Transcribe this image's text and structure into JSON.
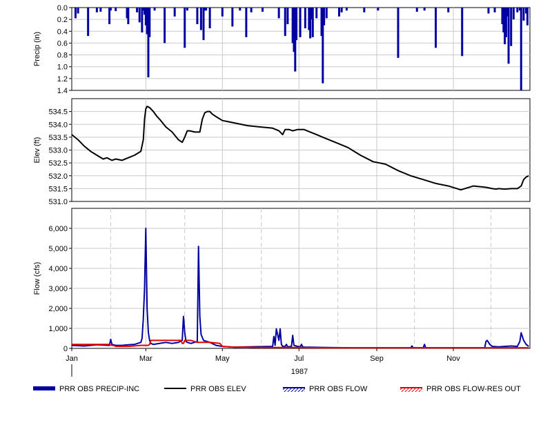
{
  "chart_data": [
    {
      "type": "bar",
      "panel": "precip",
      "ylabel": "Precip (in)",
      "yticks": [
        "0.0",
        "0.2",
        "0.4",
        "0.6",
        "0.8",
        "1.0",
        "1.2",
        "1.4"
      ],
      "ylim": [
        0,
        1.4
      ],
      "y_inverted": true,
      "grid": true,
      "series": [
        {
          "name": "PRR OBS PRECIP-INC",
          "color": "#0000a0",
          "x_days": [
            3,
            5,
            13,
            20,
            23,
            30,
            31,
            35,
            44,
            45,
            52,
            54,
            56,
            57,
            58,
            59,
            60,
            61,
            62,
            66,
            74,
            82,
            90,
            92,
            100,
            103,
            105,
            106,
            107,
            110,
            120,
            128,
            134,
            139,
            143,
            152,
            165,
            170,
            172,
            176,
            177,
            178,
            179,
            182,
            186,
            189,
            190,
            191,
            192,
            195,
            199,
            200,
            201,
            203,
            213,
            215,
            219,
            233,
            244,
            260,
            275,
            281,
            290,
            300,
            311,
            332,
            337,
            343,
            344,
            345,
            346,
            347,
            348,
            350,
            352,
            355,
            357,
            358,
            360,
            362,
            363
          ],
          "values": [
            0.18,
            0.1,
            0.48,
            0.08,
            0.07,
            0.28,
            0.05,
            0.06,
            0.18,
            0.28,
            0.08,
            0.25,
            0.42,
            0.05,
            0.12,
            0.3,
            0.45,
            1.18,
            0.5,
            0.05,
            0.6,
            0.15,
            0.68,
            0.05,
            0.28,
            0.38,
            0.55,
            0.05,
            0.05,
            0.35,
            0.15,
            0.32,
            0.05,
            0.5,
            0.08,
            0.07,
            0.18,
            0.48,
            0.28,
            0.6,
            0.75,
            1.08,
            0.55,
            0.5,
            0.35,
            0.38,
            0.52,
            0.2,
            0.5,
            0.18,
            0.48,
            1.28,
            0.3,
            0.18,
            0.15,
            0.08,
            0.05,
            0.08,
            0.05,
            0.85,
            0.07,
            0.05,
            0.68,
            0.08,
            0.82,
            0.1,
            0.08,
            0.28,
            0.42,
            0.62,
            0.5,
            0.15,
            0.95,
            0.65,
            0.2,
            0.08,
            0.05,
            1.4,
            0.22,
            0.1,
            0.3
          ]
        }
      ]
    },
    {
      "type": "line",
      "panel": "elev",
      "ylabel": "Elev (ft)",
      "yticks": [
        "531.0",
        "531.5",
        "532.0",
        "532.5",
        "533.0",
        "533.5",
        "534.0",
        "534.5"
      ],
      "ylim": [
        531.0,
        535.0
      ],
      "grid": true,
      "series": [
        {
          "name": "PRR OBS ELEV",
          "color": "#000000",
          "x_days": [
            0,
            5,
            10,
            15,
            20,
            25,
            28,
            32,
            35,
            40,
            45,
            50,
            55,
            57,
            58,
            59,
            60,
            62,
            65,
            68,
            70,
            75,
            80,
            85,
            88,
            90,
            92,
            94,
            98,
            102,
            104,
            106,
            108,
            110,
            112,
            115,
            120,
            125,
            130,
            140,
            150,
            160,
            165,
            168,
            170,
            173,
            176,
            180,
            185,
            190,
            195,
            200,
            210,
            220,
            230,
            240,
            250,
            260,
            270,
            280,
            290,
            300,
            310,
            320,
            330,
            335,
            338,
            340,
            345,
            350,
            355,
            358,
            360,
            362,
            364
          ],
          "values": [
            533.6,
            533.4,
            533.15,
            532.95,
            532.8,
            532.65,
            532.7,
            532.6,
            532.65,
            532.6,
            532.7,
            532.8,
            532.95,
            533.4,
            534.2,
            534.6,
            534.7,
            534.65,
            534.5,
            534.3,
            534.2,
            533.9,
            533.7,
            533.4,
            533.3,
            533.5,
            533.75,
            533.75,
            533.7,
            533.7,
            534.2,
            534.45,
            534.5,
            534.5,
            534.4,
            534.3,
            534.15,
            534.1,
            534.05,
            533.95,
            533.9,
            533.85,
            533.75,
            533.6,
            533.8,
            533.8,
            533.75,
            533.8,
            533.8,
            533.7,
            533.6,
            533.5,
            533.3,
            533.1,
            532.8,
            532.55,
            532.45,
            532.2,
            532.0,
            531.85,
            531.7,
            531.6,
            531.45,
            531.6,
            531.55,
            531.5,
            531.48,
            531.5,
            531.48,
            531.5,
            531.5,
            531.6,
            531.85,
            531.95,
            532.0
          ]
        }
      ]
    },
    {
      "type": "line",
      "panel": "flow",
      "ylabel": "Flow (cfs)",
      "yticks": [
        "0",
        "1,000",
        "2,000",
        "3,000",
        "4,000",
        "5,000",
        "6,000"
      ],
      "ylim": [
        0,
        7000
      ],
      "grid": true,
      "xticks": [
        "Jan",
        "Mar",
        "May",
        "Jul",
        "Sep",
        "Nov"
      ],
      "xtick_days": [
        0,
        59,
        120,
        181,
        243,
        304
      ],
      "dashed_gridline_days": [
        31,
        90,
        151,
        212,
        273,
        334
      ],
      "xlabel": "1987",
      "series": [
        {
          "name": "PRR OBS FLOW",
          "color": "#0000a0",
          "x_days": [
            0,
            10,
            20,
            30,
            31,
            32,
            35,
            40,
            45,
            50,
            55,
            56,
            57,
            58,
            59,
            60,
            61,
            62,
            63,
            65,
            70,
            75,
            80,
            85,
            88,
            89,
            90,
            91,
            92,
            95,
            100,
            101,
            102,
            103,
            105,
            110,
            115,
            120,
            125,
            130,
            140,
            160,
            161,
            162,
            163,
            165,
            166,
            167,
            168,
            170,
            171,
            172,
            175,
            176,
            177,
            180,
            182,
            183,
            184,
            186,
            190,
            200,
            220,
            240,
            260,
            270,
            271,
            272,
            280,
            281,
            282,
            300,
            320,
            329,
            330,
            331,
            333,
            335,
            340,
            345,
            350,
            355,
            357,
            358,
            360,
            362,
            364
          ],
          "values": [
            150,
            120,
            180,
            150,
            450,
            200,
            150,
            150,
            180,
            200,
            300,
            500,
            1500,
            3000,
            6000,
            2000,
            800,
            400,
            250,
            200,
            250,
            300,
            250,
            300,
            400,
            1600,
            800,
            350,
            300,
            250,
            350,
            5100,
            1600,
            700,
            400,
            300,
            150,
            100,
            80,
            60,
            80,
            100,
            600,
            150,
            980,
            400,
            980,
            200,
            100,
            100,
            200,
            80,
            100,
            650,
            150,
            100,
            80,
            200,
            80,
            60,
            60,
            50,
            30,
            30,
            30,
            30,
            120,
            30,
            30,
            200,
            30,
            30,
            30,
            30,
            350,
            400,
            200,
            100,
            80,
            100,
            120,
            100,
            350,
            780,
            400,
            200,
            100
          ]
        },
        {
          "name": "PRR OBS FLOW-RES OUT",
          "color": "#e00000",
          "x_days": [
            0,
            30,
            31,
            34,
            35,
            45,
            55,
            58,
            59,
            60,
            61,
            62,
            63,
            87,
            88,
            89,
            90,
            91,
            95,
            100,
            110,
            118,
            120,
            130,
            140,
            150,
            160,
            180,
            200,
            220,
            240,
            260,
            280,
            300,
            320,
            340,
            360,
            364
          ],
          "values": [
            200,
            200,
            170,
            130,
            100,
            100,
            150,
            150,
            150,
            150,
            150,
            200,
            400,
            400,
            250,
            250,
            400,
            400,
            400,
            300,
            300,
            250,
            100,
            60,
            60,
            40,
            40,
            40,
            30,
            30,
            30,
            30,
            30,
            30,
            30,
            30,
            30,
            30
          ]
        }
      ]
    }
  ],
  "legend": [
    {
      "label": "PRR OBS PRECIP-INC",
      "color": "#0000a0",
      "style": "thick"
    },
    {
      "label": "PRR OBS ELEV",
      "color": "#000000",
      "style": "line"
    },
    {
      "label": "PRR OBS FLOW",
      "color": "#0000a0",
      "style": "hatch"
    },
    {
      "label": "PRR OBS FLOW-RES OUT",
      "color": "#e00000",
      "style": "hatch"
    }
  ]
}
